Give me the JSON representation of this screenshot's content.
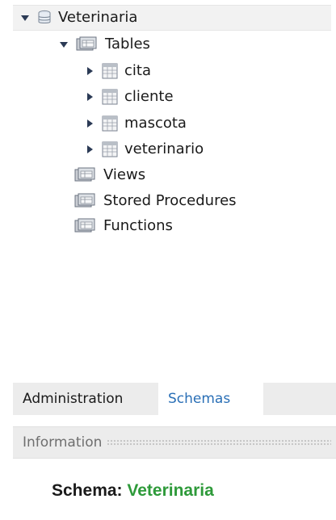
{
  "tree": {
    "schema": {
      "label": "Veterinaria",
      "icon": "database-icon",
      "expanded": true
    },
    "tables_node": {
      "label": "Tables",
      "icon": "folder-icon",
      "expanded": true
    },
    "tables": [
      {
        "label": "cita",
        "icon": "table-icon"
      },
      {
        "label": "cliente",
        "icon": "table-icon"
      },
      {
        "label": "mascota",
        "icon": "table-icon"
      },
      {
        "label": "veterinario",
        "icon": "table-icon"
      }
    ],
    "groups": [
      {
        "label": "Views",
        "icon": "folder-icon"
      },
      {
        "label": "Stored Procedures",
        "icon": "folder-icon"
      },
      {
        "label": "Functions",
        "icon": "folder-icon"
      }
    ]
  },
  "tabs": {
    "administration": "Administration",
    "schemas": "Schemas",
    "active": "Schemas"
  },
  "information": {
    "title": "Information",
    "schema_key": "Schema:",
    "schema_value": "Veterinaria"
  },
  "colors": {
    "tab_active_text": "#2a6fb6",
    "schema_value": "#2e9a3a"
  }
}
